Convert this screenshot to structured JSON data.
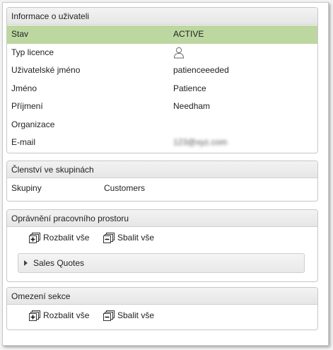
{
  "user_info": {
    "title": "Informace o uživateli",
    "rows": [
      {
        "label": "Stav",
        "value": "ACTIVE"
      },
      {
        "label": "Typ licence",
        "value": "",
        "icon": "user-icon"
      },
      {
        "label": "Uživatelské jméno",
        "value": "patienceeeded"
      },
      {
        "label": "Jméno",
        "value": "Patience"
      },
      {
        "label": "Příjmení",
        "value": "Needham"
      },
      {
        "label": "Organizace",
        "value": ""
      },
      {
        "label": "E-mail",
        "value": "123@xyz.com"
      }
    ],
    "highlight_color": "#bcd7a0"
  },
  "membership": {
    "title": "Členství ve skupinách",
    "label": "Skupiny",
    "value": "Customers"
  },
  "workspace_perms": {
    "title": "Oprávnění pracovního prostoru",
    "expand_all": "Rozbalit vše",
    "collapse_all": "Sbalit vše",
    "section_label": "Sales Quotes",
    "expand_icon": "expand-all-icon",
    "collapse_icon": "collapse-all-icon"
  },
  "section_restrictions": {
    "title": "Omezení sekce",
    "expand_all": "Rozbalit vše",
    "collapse_all": "Sbalit vše"
  }
}
